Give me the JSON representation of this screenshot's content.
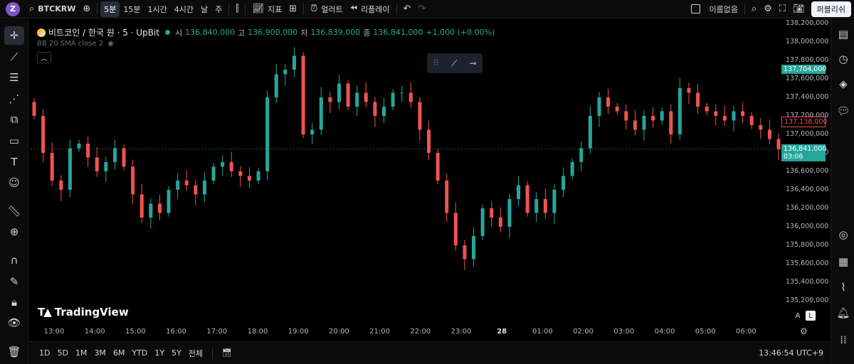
{
  "topbar": {
    "avatar_letter": "Z",
    "symbol": "BTCKRW",
    "timeframes": [
      "5분",
      "15분",
      "1시간",
      "4시간",
      "날",
      "주"
    ],
    "active_timeframe": "5분",
    "indicators_label": "지표",
    "alert_label": "얼러트",
    "replay_label": "리플레이",
    "layout_name": "이름없음",
    "publish_label": "퍼블리쉬"
  },
  "legend": {
    "title": "비트코인 / 한국 원 · 5 · UpBit",
    "open_label": "시",
    "open": "136,840,000",
    "high_label": "고",
    "high": "136,900,000",
    "low_label": "저",
    "low": "136,839,000",
    "close_label": "종",
    "close": "136,841,000",
    "change": "+1,000 (+0.00%)",
    "indicator": "BB 20 SMA close 2"
  },
  "watermark": "TradingView",
  "price_axis": {
    "ticks": [
      "138,200,000",
      "138,000,000",
      "137,800,000",
      "137,600,000",
      "137,400,000",
      "137,200,000",
      "137,000,000",
      "136,800,000",
      "136,600,000",
      "136,400,000",
      "136,200,000",
      "136,000,000",
      "135,800,000",
      "135,600,000",
      "135,400,000",
      "135,200,000"
    ],
    "badge_high": "137,704,000",
    "badge_mid": "137,138,000",
    "badge_last": "136,841,000",
    "badge_countdown": "03:06",
    "auto_label": "A",
    "log_label": "L"
  },
  "time_axis": {
    "ticks": [
      "13:00",
      "14:00",
      "15:00",
      "16:00",
      "17:00",
      "18:00",
      "19:00",
      "20:00",
      "21:00",
      "22:00",
      "23:00",
      "28",
      "01:00",
      "02:00",
      "03:00",
      "04:00",
      "05:00",
      "06:00"
    ]
  },
  "bottombar": {
    "ranges": [
      "1D",
      "5D",
      "1M",
      "3M",
      "6M",
      "YTD",
      "1Y",
      "5Y",
      "전체"
    ],
    "clock": "13:46:54 UTC+9"
  },
  "colors": {
    "up": "#26a69a",
    "down": "#ef5350",
    "background": "#000000"
  },
  "chart_data": {
    "type": "candlestick",
    "pair": "BTC/KRW",
    "interval": "5",
    "ylim": [
      135100000,
      138250000
    ],
    "last_price": 136841000,
    "closes": [
      137200000,
      136800000,
      136500000,
      136400000,
      136850000,
      136900000,
      136750000,
      136600000,
      136700000,
      136850000,
      136650000,
      136350000,
      136100000,
      136250000,
      136150000,
      136400000,
      136500000,
      136450000,
      136350000,
      136500000,
      136650000,
      136700000,
      136600000,
      136550000,
      136500000,
      136600000,
      137400000,
      137650000,
      137700000,
      137850000,
      137000000,
      137050000,
      137400000,
      137350000,
      137550000,
      137300000,
      137450000,
      137350000,
      137200000,
      137300000,
      137450000,
      137450000,
      137350000,
      137050000,
      136800000,
      136500000,
      136150000,
      135800000,
      135650000,
      135900000,
      136200000,
      136100000,
      136000000,
      136300000,
      136450000,
      136150000,
      136300000,
      136150000,
      136400000,
      136550000,
      136700000,
      136850000,
      137200000,
      137400000,
      137300000,
      137250000,
      137150000,
      137050000,
      137200000,
      137150000,
      137250000,
      137000000,
      137500000,
      137450000,
      137300000,
      137250000,
      137200000,
      137150000,
      137250000,
      137200000,
      137100000,
      137050000,
      136950000,
      136841000
    ]
  }
}
